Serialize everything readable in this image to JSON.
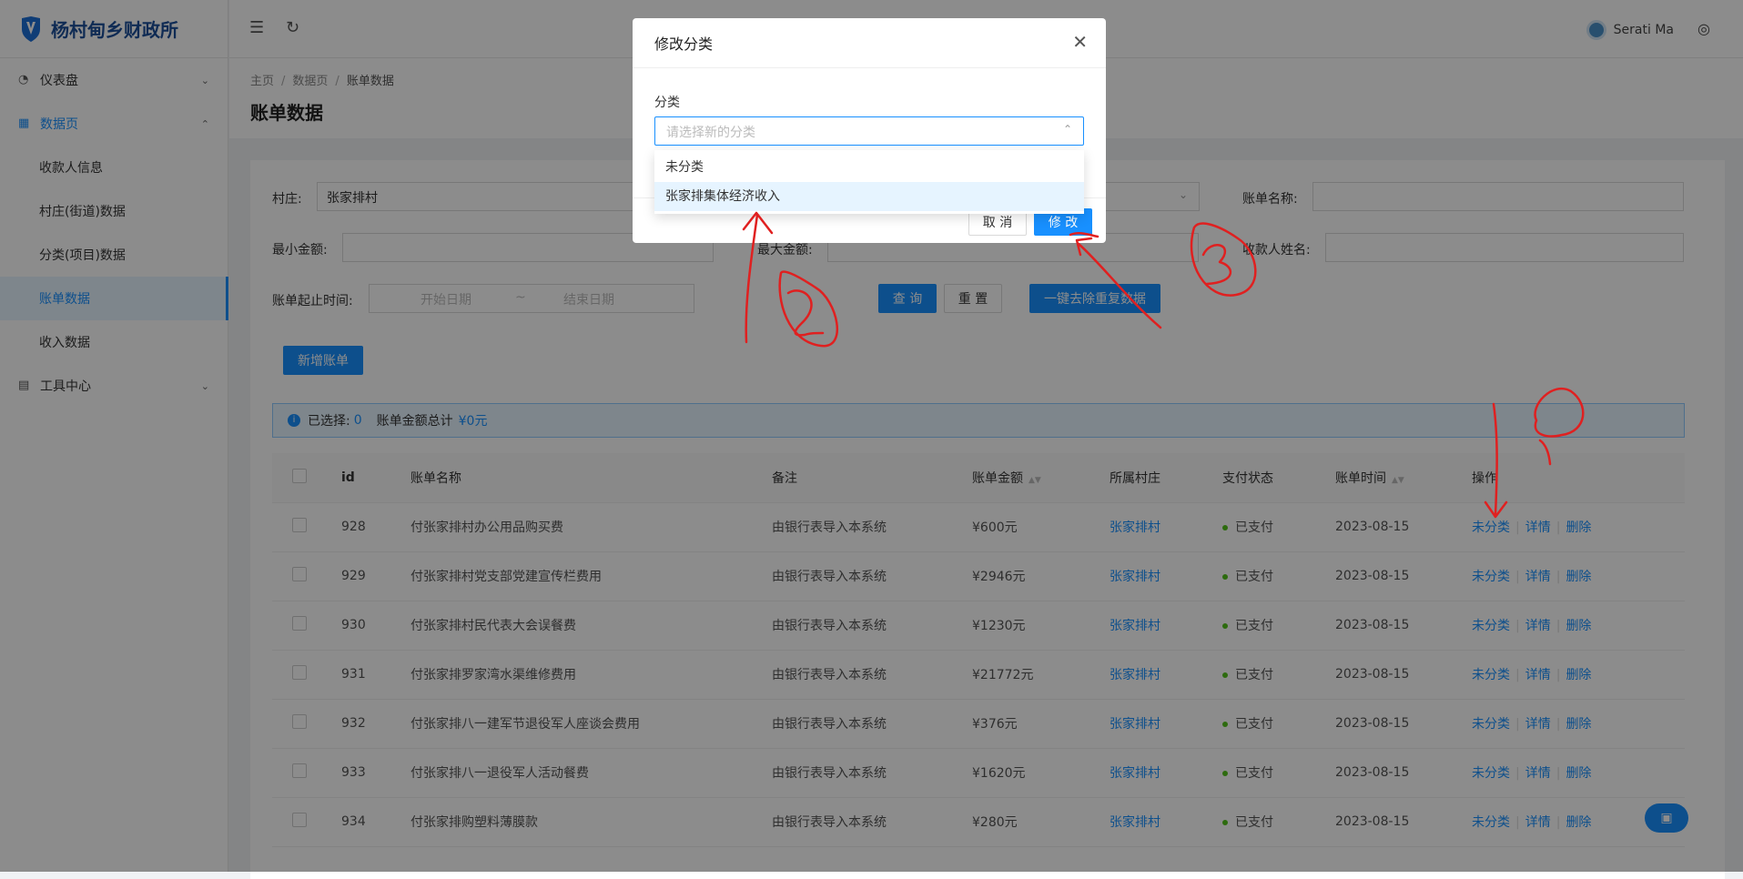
{
  "sidebar": {
    "brand": "杨村甸乡财政所",
    "items": [
      {
        "label": "仪表盘"
      },
      {
        "label": "数据页"
      },
      {
        "label": "收款人信息"
      },
      {
        "label": "村庄(街道)数据"
      },
      {
        "label": "分类(项目)数据"
      },
      {
        "label": "账单数据"
      },
      {
        "label": "收入数据"
      },
      {
        "label": "工具中心"
      }
    ]
  },
  "topbar": {
    "user_name": "Serati Ma"
  },
  "breadcrumb": [
    "主页",
    "数据页",
    "账单数据"
  ],
  "page_title": "账单数据",
  "filters": {
    "village_label": "村庄:",
    "village_value": "张家排村",
    "bill_name_label": "账单名称:",
    "min_amount_label": "最小金额:",
    "max_amount_label": "最大金额:",
    "payee_label": "收款人姓名:",
    "date_label": "账单起止时间:",
    "start_placeholder": "开始日期",
    "date_sep": "~",
    "end_placeholder": "结束日期",
    "query_button": "查 询",
    "reset_button": "重 置",
    "dedupe_button": "一键去除重复数据"
  },
  "add_button": "新增账单",
  "selection": {
    "selected_label": "已选择:",
    "selected_count": "0",
    "total_label": "账单金额总计",
    "total_value": "¥0元"
  },
  "table": {
    "columns": [
      "id",
      "账单名称",
      "备注",
      "账单金额",
      "所属村庄",
      "支付状态",
      "账单时间",
      "操作"
    ],
    "rows": [
      {
        "id": "928",
        "name": "付张家排村办公用品购买费",
        "note": "由银行表导入本系统",
        "amount": "¥600元",
        "village": "张家排村",
        "status": "已支付",
        "date": "2023-08-15",
        "act1": "未分类",
        "act2": "详情",
        "act3": "删除"
      },
      {
        "id": "929",
        "name": "付张家排村党支部党建宣传栏费用",
        "note": "由银行表导入本系统",
        "amount": "¥2946元",
        "village": "张家排村",
        "status": "已支付",
        "date": "2023-08-15",
        "act1": "未分类",
        "act2": "详情",
        "act3": "删除"
      },
      {
        "id": "930",
        "name": "付张家排村民代表大会误餐费",
        "note": "由银行表导入本系统",
        "amount": "¥1230元",
        "village": "张家排村",
        "status": "已支付",
        "date": "2023-08-15",
        "act1": "未分类",
        "act2": "详情",
        "act3": "删除"
      },
      {
        "id": "931",
        "name": "付张家排罗家湾水渠维修费用",
        "note": "由银行表导入本系统",
        "amount": "¥21772元",
        "village": "张家排村",
        "status": "已支付",
        "date": "2023-08-15",
        "act1": "未分类",
        "act2": "详情",
        "act3": "删除"
      },
      {
        "id": "932",
        "name": "付张家排八一建军节退役军人座谈会费用",
        "note": "由银行表导入本系统",
        "amount": "¥376元",
        "village": "张家排村",
        "status": "已支付",
        "date": "2023-08-15",
        "act1": "未分类",
        "act2": "详情",
        "act3": "删除"
      },
      {
        "id": "933",
        "name": "付张家排八一退役军人活动餐费",
        "note": "由银行表导入本系统",
        "amount": "¥1620元",
        "village": "张家排村",
        "status": "已支付",
        "date": "2023-08-15",
        "act1": "未分类",
        "act2": "详情",
        "act3": "删除"
      },
      {
        "id": "934",
        "name": "付张家排购塑料薄膜款",
        "note": "由银行表导入本系统",
        "amount": "¥280元",
        "village": "张家排村",
        "status": "已支付",
        "date": "2023-08-15",
        "act1": "未分类",
        "act2": "详情",
        "act3": "删除"
      }
    ]
  },
  "modal": {
    "title": "修改分类",
    "field_label": "分类",
    "placeholder": "请选择新的分类",
    "options": [
      "未分类",
      "张家排集体经济收入"
    ],
    "cancel": "取 消",
    "ok": "修 改"
  },
  "icons": {
    "logo": "shield-v-icon",
    "collapse": "menu-fold-icon",
    "refresh": "reload-icon",
    "language": "globe-icon"
  },
  "colors": {
    "primary": "#1890ff",
    "brand": "#1d4f9a",
    "success": "#52c41a",
    "annotation": "#e02020"
  }
}
